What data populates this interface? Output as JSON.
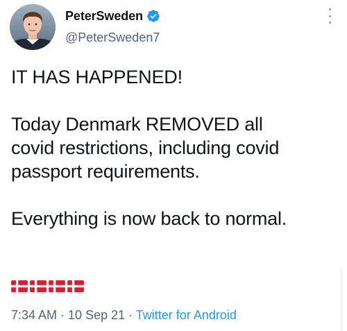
{
  "author": {
    "display_name": "PeterSweden",
    "handle": "@PeterSweden7",
    "verified": true
  },
  "tweet": {
    "lines": [
      "IT HAS HAPPENED!",
      "",
      "Today Denmark REMOVED all",
      "covid restrictions, including covid",
      "passport requirements.",
      "",
      "Everything is now back to normal."
    ],
    "emoji": [
      "flag-denmark",
      "flag-denmark",
      "flag-denmark",
      "flag-denmark"
    ]
  },
  "meta": {
    "time": "7:34 AM",
    "separator1": " · ",
    "date": "10 Sep 21",
    "separator2": " · ",
    "source": "Twitter for Android"
  },
  "icons": {
    "verified": "verified-badge-icon",
    "more": "more-options-icon"
  },
  "colors": {
    "text": "#0f1419",
    "secondary": "#536471",
    "link": "#1d9bf0",
    "verified": "#1d9bf0",
    "flag_red": "#e11b2f"
  }
}
